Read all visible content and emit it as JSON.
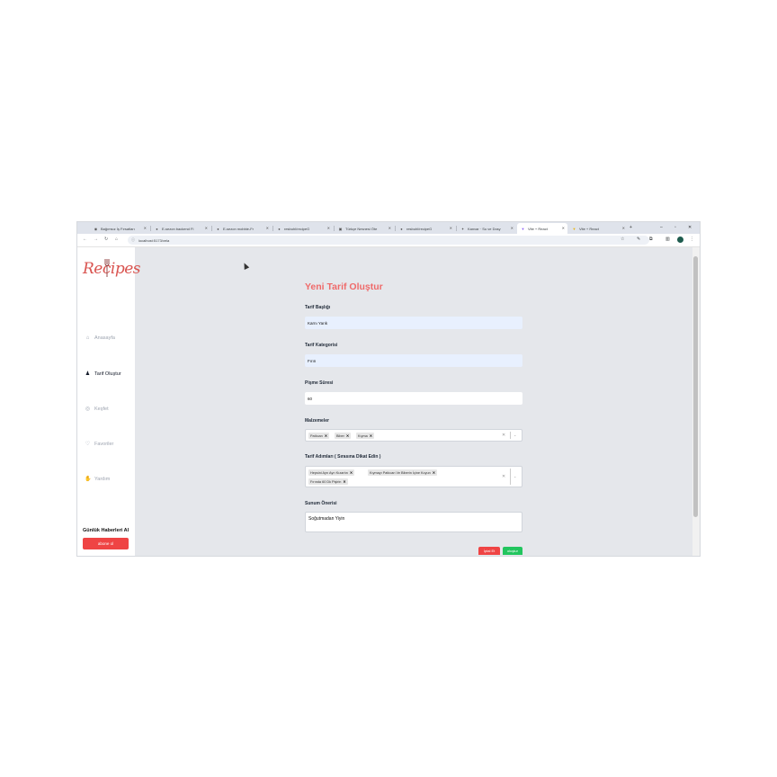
{
  "tabs": [
    {
      "title": "Bağımsız İş Fırsatları",
      "favicon": "globe-icon"
    },
    {
      "title": "E-sezon backend Fi",
      "favicon": "github-icon"
    },
    {
      "title": "E-sezon mobbie-Fr",
      "favicon": "github-icon"
    },
    {
      "title": "resbuhl/recipeG",
      "favicon": "github-icon"
    },
    {
      "title": "Türkçe Nesnesi Öte",
      "favicon": "doc-icon"
    },
    {
      "title": "resbuhl/recipeG",
      "favicon": "github-icon"
    },
    {
      "title": "Kanvar · Su ve Dosy",
      "favicon": "settings-icon"
    },
    {
      "title": "Vite + React",
      "favicon": "vite-icon",
      "active": true
    },
    {
      "title": "Vite + React",
      "favicon": "vite-icon"
    }
  ],
  "address_bar": {
    "url": "localhost:5173/vela"
  },
  "sidebar": {
    "logo_text": "Recipes",
    "items": [
      {
        "label": "Anasayfa",
        "icon": "home-icon",
        "active": false
      },
      {
        "label": "Tarif Oluştur",
        "icon": "user-icon",
        "active": true
      },
      {
        "label": "Keşfet",
        "icon": "compass-icon",
        "active": false
      },
      {
        "label": "Favoriler",
        "icon": "heart-icon",
        "active": false
      },
      {
        "label": "Yardım",
        "icon": "hands-icon",
        "active": false
      }
    ],
    "newsletter_title": "Günlük Haberleri Al",
    "newsletter_button": "abone ol"
  },
  "form": {
    "title": "Yeni Tarif Oluştur",
    "recipe_title_label": "Tarif Başlığı",
    "recipe_title_value": "Karnı Yarık",
    "category_label": "Tarif Kategorisi",
    "category_value": "Fırın",
    "cook_time_label": "Pişme Süresi",
    "cook_time_value": "60",
    "ingredients_label": "Malzemeler",
    "ingredients": [
      "Patlıcan",
      "Biber",
      "Kıyma"
    ],
    "steps_label": "Tarif Adımları ( Sırasına Dikat Edin )",
    "steps": [
      "Hepsini Ayrı Ayrı Kızartın",
      "Kıymayı Patlıcan Ve Biberin İçine Koyun",
      "Fırında 60 Dk Pişirin"
    ],
    "serving_label": "Sunum Önerisi",
    "serving_value": "Soğutmadan Yiyin",
    "cancel_label": "İptal Et",
    "submit_label": "oluştur"
  },
  "colors": {
    "accent": "#ef6a6a",
    "danger": "#ef4444",
    "success": "#22c55e",
    "background": "#e5e7eb"
  }
}
